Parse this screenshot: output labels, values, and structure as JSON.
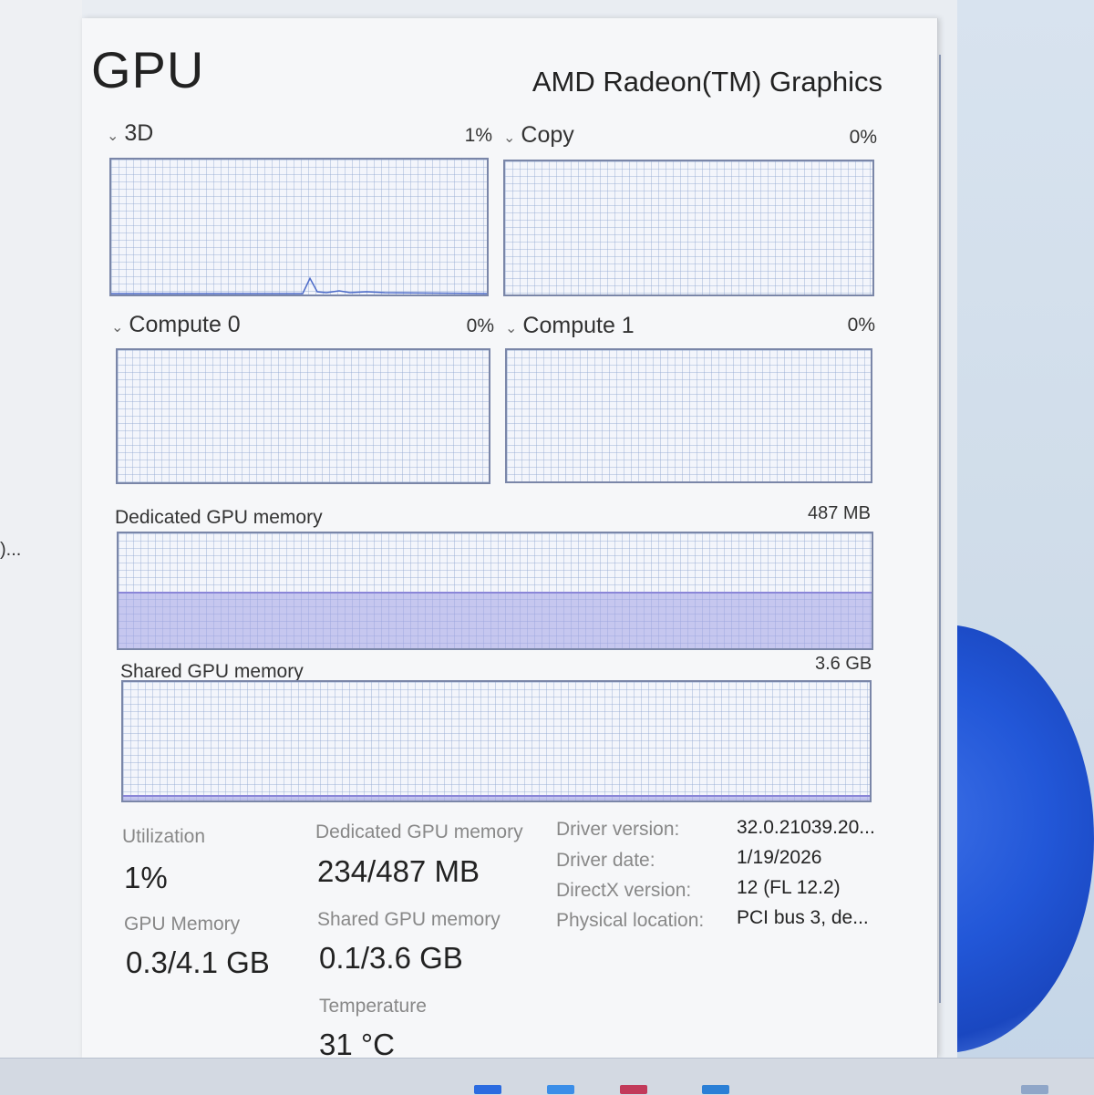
{
  "left_panel": {
    "truncated_text": ")..."
  },
  "header": {
    "title": "GPU",
    "gpu_name": "AMD Radeon(TM) Graphics"
  },
  "engines": [
    {
      "label": "3D",
      "percent": "1%",
      "utilization": 0.01
    },
    {
      "label": "Copy",
      "percent": "0%",
      "utilization": 0
    },
    {
      "label": "Compute 0",
      "percent": "0%",
      "utilization": 0
    },
    {
      "label": "Compute 1",
      "percent": "0%",
      "utilization": 0
    }
  ],
  "dedicated_memory": {
    "label": "Dedicated GPU memory",
    "max": "487 MB",
    "usage_fraction": 0.48
  },
  "shared_memory": {
    "label": "Shared GPU memory",
    "max": "3.6 GB",
    "usage_fraction": 0.03
  },
  "stats": {
    "utilization_label": "Utilization",
    "utilization_value": "1%",
    "gpu_memory_label": "GPU Memory",
    "gpu_memory_value": "0.3/4.1 GB",
    "dedicated_label": "Dedicated GPU memory",
    "dedicated_value": "234/487 MB",
    "shared_label": "Shared GPU memory",
    "shared_value": "0.1/3.6 GB",
    "temperature_label": "Temperature",
    "temperature_value": "31 °C"
  },
  "info": {
    "driver_version_label": "Driver version:",
    "driver_version_value": "32.0.21039.20...",
    "driver_date_label": "Driver date:",
    "driver_date_value": "1/19/2026",
    "directx_label": "DirectX version:",
    "directx_value": "12 (FL 12.2)",
    "physical_location_label": "Physical location:",
    "physical_location_value": "PCI bus 3, de..."
  },
  "colors": {
    "graph_border": "#7a86a8",
    "memory_fill": "#a0a0e6",
    "desktop_accent": "#2257d8"
  }
}
